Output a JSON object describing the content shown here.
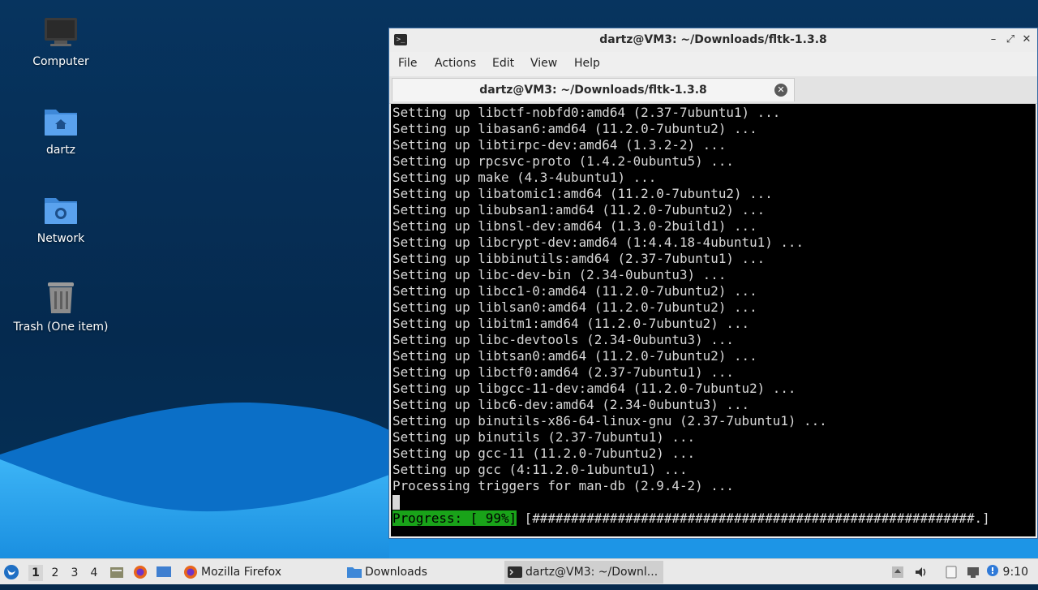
{
  "desktop": {
    "icons": [
      {
        "label": "Computer",
        "icon": "computer-icon"
      },
      {
        "label": "dartz",
        "icon": "home-folder-icon"
      },
      {
        "label": "Network",
        "icon": "network-folder-icon"
      },
      {
        "label": "Trash (One item)",
        "icon": "trash-icon"
      }
    ],
    "colors": {
      "background": "#062a4d",
      "wave_light": "#2aa8f2",
      "wave_dark": "#0a63b8"
    }
  },
  "window": {
    "title": "dartz@VM3: ~/Downloads/fltk-1.3.8",
    "menu": [
      "File",
      "Actions",
      "Edit",
      "View",
      "Help"
    ],
    "tab_label": "dartz@VM3: ~/Downloads/fltk-1.3.8",
    "terminal": {
      "lines": [
        "Setting up libctf-nobfd0:amd64 (2.37-7ubuntu1) ...",
        "Setting up libasan6:amd64 (11.2.0-7ubuntu2) ...",
        "Setting up libtirpc-dev:amd64 (1.3.2-2) ...",
        "Setting up rpcsvc-proto (1.4.2-0ubuntu5) ...",
        "Setting up make (4.3-4ubuntu1) ...",
        "Setting up libatomic1:amd64 (11.2.0-7ubuntu2) ...",
        "Setting up libubsan1:amd64 (11.2.0-7ubuntu2) ...",
        "Setting up libnsl-dev:amd64 (1.3.0-2build1) ...",
        "Setting up libcrypt-dev:amd64 (1:4.4.18-4ubuntu1) ...",
        "Setting up libbinutils:amd64 (2.37-7ubuntu1) ...",
        "Setting up libc-dev-bin (2.34-0ubuntu3) ...",
        "Setting up libcc1-0:amd64 (11.2.0-7ubuntu2) ...",
        "Setting up liblsan0:amd64 (11.2.0-7ubuntu2) ...",
        "Setting up libitm1:amd64 (11.2.0-7ubuntu2) ...",
        "Setting up libc-devtools (2.34-0ubuntu3) ...",
        "Setting up libtsan0:amd64 (11.2.0-7ubuntu2) ...",
        "Setting up libctf0:amd64 (2.37-7ubuntu1) ...",
        "Setting up libgcc-11-dev:amd64 (11.2.0-7ubuntu2) ...",
        "Setting up libc6-dev:amd64 (2.34-0ubuntu3) ...",
        "Setting up binutils-x86-64-linux-gnu (2.37-7ubuntu1) ...",
        "Setting up binutils (2.37-7ubuntu1) ...",
        "Setting up gcc-11 (11.2.0-7ubuntu2) ...",
        "Setting up gcc (4:11.2.0-1ubuntu1) ...",
        "Processing triggers for man-db (2.9.4-2) ..."
      ],
      "progress_label": "Progress: [ 99%]",
      "progress_bar": "[#########################################################.]",
      "progress_percent": 99,
      "colors": {
        "background": "#000000",
        "text": "#d8d8d8",
        "progress": "#19a319"
      }
    }
  },
  "taskbar": {
    "workspaces": [
      "1",
      "2",
      "3",
      "4"
    ],
    "active_workspace": "1",
    "tasks": [
      {
        "label": "Mozilla Firefox",
        "icon": "firefox-icon"
      },
      {
        "label": "Downloads",
        "icon": "folder-icon"
      },
      {
        "label": "dartz@VM3: ~/Downl...",
        "icon": "terminal-icon"
      }
    ],
    "clock": "9:10"
  }
}
